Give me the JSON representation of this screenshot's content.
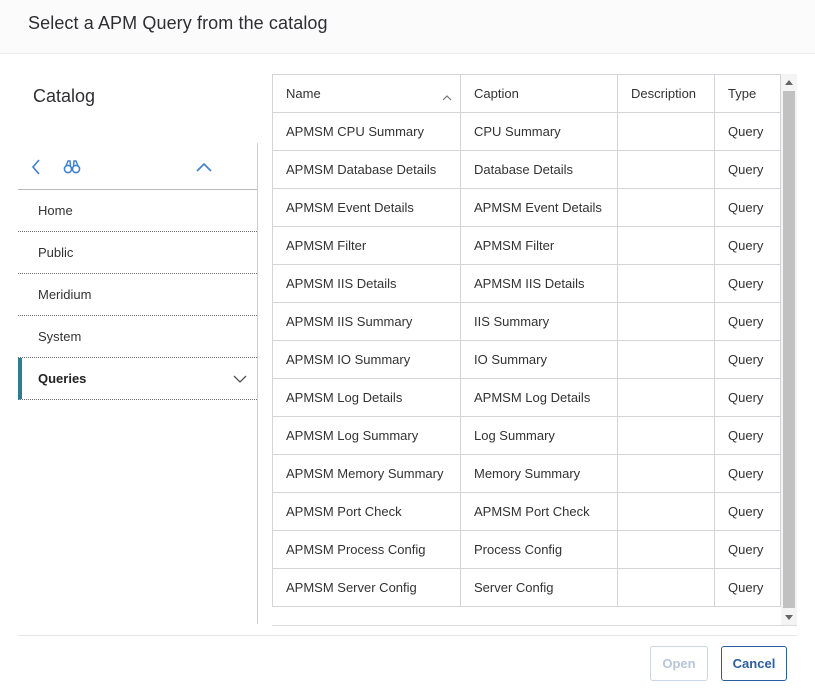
{
  "dialog": {
    "title": "Select a APM Query from the catalog"
  },
  "catalog": {
    "title": "Catalog",
    "toolbar": {
      "back_icon": "chevron-left-icon",
      "find_icon": "binoculars-icon",
      "collapse_icon": "chevron-up-icon"
    },
    "items": [
      {
        "label": "Home",
        "active": false
      },
      {
        "label": "Public",
        "active": false
      },
      {
        "label": "Meridium",
        "active": false
      },
      {
        "label": "System",
        "active": false
      },
      {
        "label": "Queries",
        "active": true
      }
    ],
    "active_color": "#2d7d8f"
  },
  "grid": {
    "columns": [
      "Name",
      "Caption",
      "Description",
      "Type"
    ],
    "sort_column": "Name",
    "sort_direction": "ascending",
    "rows": [
      {
        "name": "APMSM CPU Summary",
        "caption": "CPU Summary",
        "description": "",
        "type": "Query"
      },
      {
        "name": "APMSM Database Details",
        "caption": "Database Details",
        "description": "",
        "type": "Query"
      },
      {
        "name": "APMSM Event Details",
        "caption": "APMSM Event Details",
        "description": "",
        "type": "Query"
      },
      {
        "name": "APMSM Filter",
        "caption": "APMSM Filter",
        "description": "",
        "type": "Query"
      },
      {
        "name": "APMSM IIS Details",
        "caption": "APMSM IIS Details",
        "description": "",
        "type": "Query"
      },
      {
        "name": "APMSM IIS Summary",
        "caption": "IIS Summary",
        "description": "",
        "type": "Query"
      },
      {
        "name": "APMSM IO Summary",
        "caption": "IO Summary",
        "description": "",
        "type": "Query"
      },
      {
        "name": "APMSM Log Details",
        "caption": "APMSM Log Details",
        "description": "",
        "type": "Query"
      },
      {
        "name": "APMSM Log Summary",
        "caption": "Log Summary",
        "description": "",
        "type": "Query"
      },
      {
        "name": "APMSM Memory Summary",
        "caption": "Memory Summary",
        "description": "",
        "type": "Query"
      },
      {
        "name": "APMSM Port Check",
        "caption": "APMSM Port Check",
        "description": "",
        "type": "Query"
      },
      {
        "name": "APMSM Process Config",
        "caption": "Process Config",
        "description": "",
        "type": "Query"
      },
      {
        "name": "APMSM Server Config",
        "caption": "Server Config",
        "description": "",
        "type": "Query"
      }
    ]
  },
  "footer": {
    "open_label": "Open",
    "open_enabled": false,
    "cancel_label": "Cancel",
    "accent_color": "#2a5f9e"
  }
}
